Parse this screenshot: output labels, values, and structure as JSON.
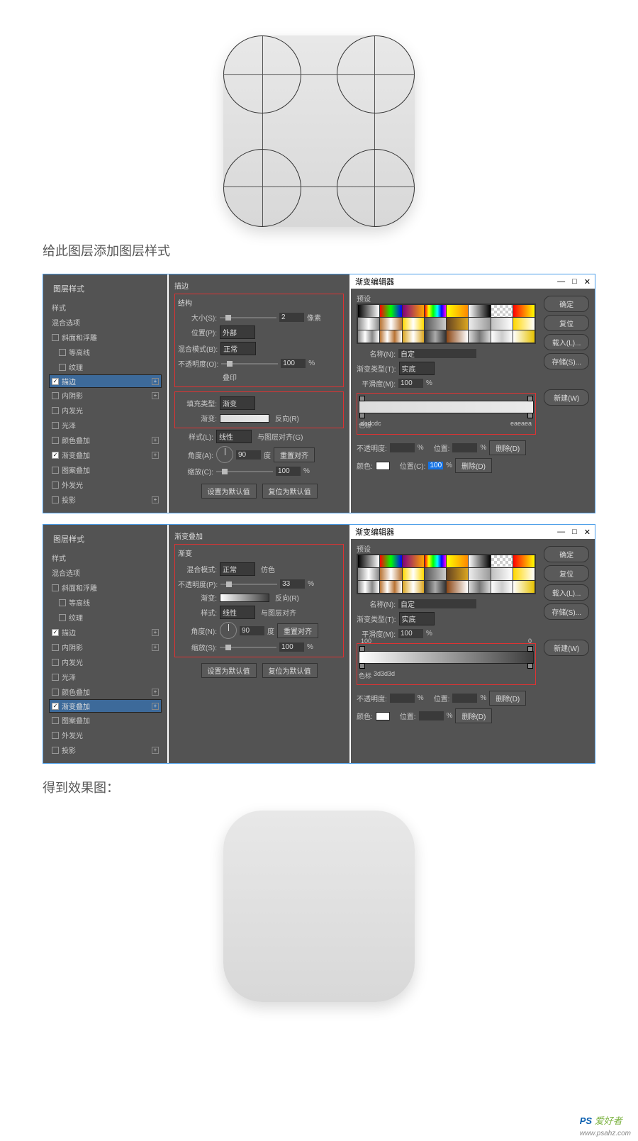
{
  "captions": {
    "c1": "给此图层添加图层样式",
    "c2": "得到效果图："
  },
  "dialog": {
    "title": "图层样式",
    "styles_header": "样式",
    "blend_header": "混合选项",
    "items": {
      "bevel": "斜面和浮雕",
      "contour": "等高线",
      "texture": "纹理",
      "stroke": "描边",
      "inner_shadow": "内阴影",
      "inner_glow": "内发光",
      "satin": "光泽",
      "color_overlay": "颜色叠加",
      "gradient_overlay": "渐变叠加",
      "pattern_overlay": "图案叠加",
      "outer_glow": "外发光",
      "drop_shadow": "投影"
    }
  },
  "stroke": {
    "title": "描边",
    "section": "结构",
    "size_label": "大小(S):",
    "size_val": "2",
    "size_unit": "像素",
    "position_label": "位置(P):",
    "position_val": "外部",
    "blend_label": "混合模式(B):",
    "blend_val": "正常",
    "opacity_label": "不透明度(O):",
    "opacity_val": "100",
    "opacity_unit": "%",
    "overprint": "叠印",
    "fill_type_label": "填充类型:",
    "fill_type_val": "渐变",
    "gradient_label": "渐变:",
    "reverse": "反向(R)",
    "style_label": "样式(L):",
    "style_val": "线性",
    "align": "与图层对齐(G)",
    "angle_label": "角度(A):",
    "angle_val": "90",
    "angle_unit": "度",
    "reset_align": "重置对齐",
    "scale_label": "缩放(C):",
    "scale_val": "100",
    "scale_unit": "%",
    "make_default": "设置为默认值",
    "reset_default": "复位为默认值"
  },
  "gradov": {
    "title": "渐变叠加",
    "section": "渐变",
    "blend_label": "混合模式:",
    "blend_val": "正常",
    "dither": "仿色",
    "opacity_label": "不透明度(P):",
    "opacity_val": "33",
    "opacity_unit": "%",
    "gradient_label": "渐变:",
    "reverse": "反向(R)",
    "style_label": "样式:",
    "style_val": "线性",
    "align": "与图层对齐",
    "angle_label": "角度(N):",
    "angle_val": "90",
    "angle_unit": "度",
    "reset_align": "重置对齐",
    "scale_label": "缩放(S):",
    "scale_val": "100",
    "scale_unit": "%",
    "make_default": "设置为默认值",
    "reset_default": "复位为默认值"
  },
  "editor": {
    "title": "渐变编辑器",
    "presets": "预设",
    "ok": "确定",
    "cancel": "复位",
    "load": "载入(L)...",
    "save": "存储(S)...",
    "new": "新建(W)",
    "name_label": "名称(N):",
    "name_val": "自定",
    "type_label": "渐变类型(T):",
    "type_val": "实底",
    "smooth_label": "平滑度(M):",
    "smooth_val": "100",
    "smooth_unit": "%",
    "stops": {
      "left1": "dcdcdc",
      "right1": "eaeaea",
      "left2": "100",
      "right2": "0",
      "mid2": "3d3d3d",
      "label": "色标"
    },
    "bottom": {
      "opacity": "不透明度:",
      "opacity_unit": "%",
      "position": "位置:",
      "position2": "位置(C):",
      "position_val": "100",
      "position_unit": "%",
      "delete": "删除(D)",
      "color": "颜色:"
    }
  },
  "watermark": {
    "brand1": "PS",
    "brand2": "爱好者",
    "url": "www.psahz.com"
  }
}
